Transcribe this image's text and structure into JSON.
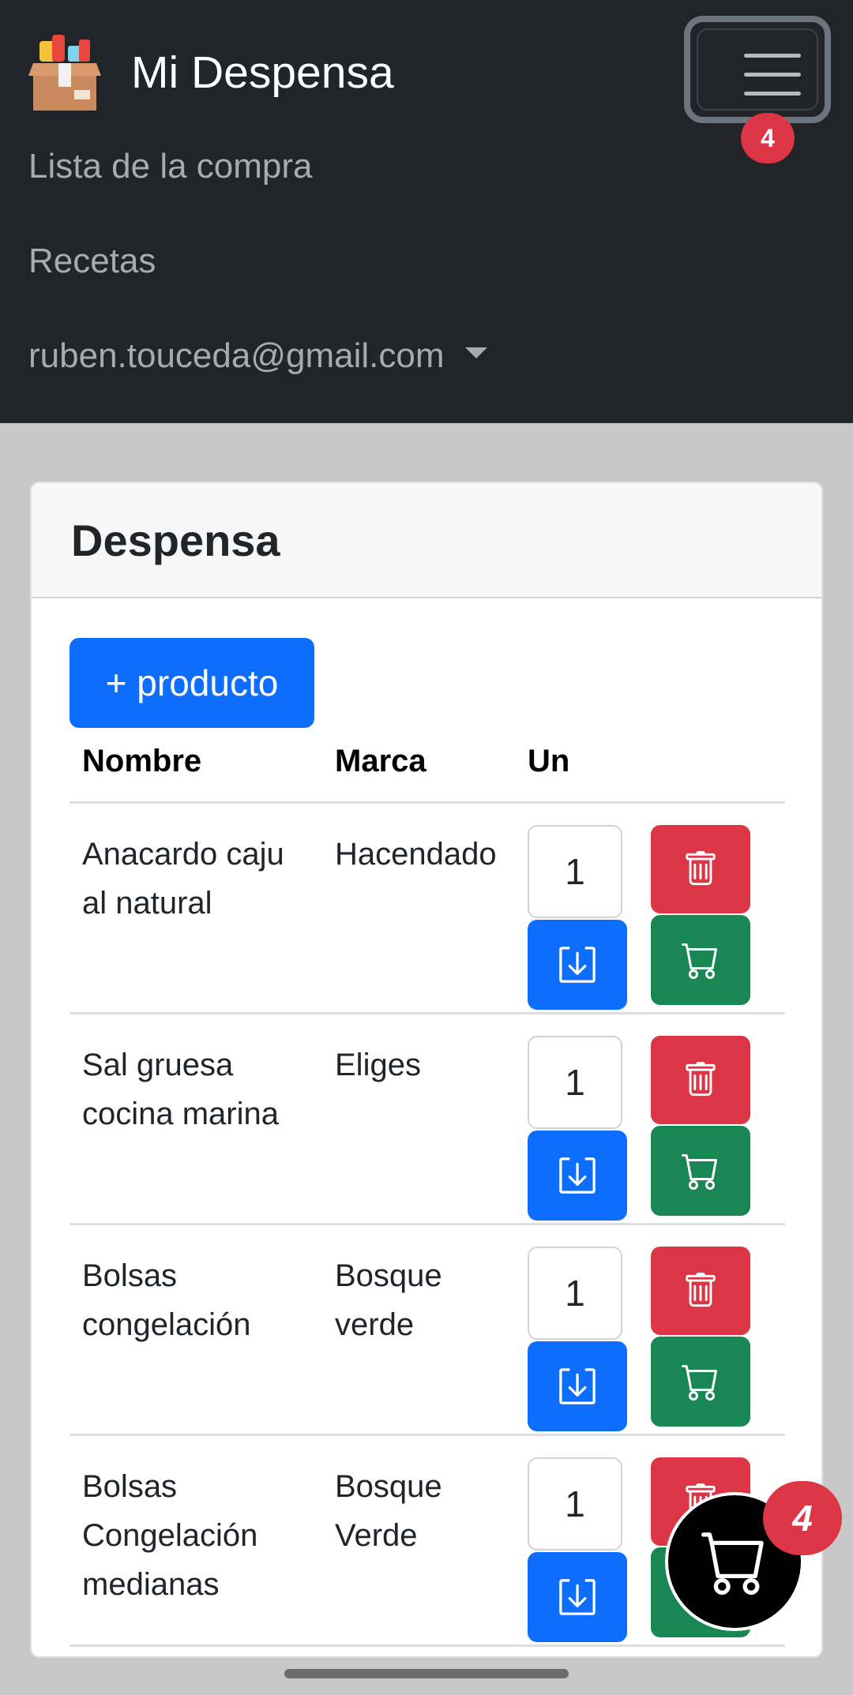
{
  "app": {
    "title": "Mi Despensa",
    "logo_icon": "pantry-box-icon"
  },
  "nav": {
    "toggle_badge": "4",
    "links": [
      {
        "label": "Lista de la compra"
      },
      {
        "label": "Recetas"
      },
      {
        "label": "ruben.touceda@gmail.com"
      }
    ]
  },
  "card": {
    "title": "Despensa",
    "add_button": "+ producto",
    "headers": {
      "name": "Nombre",
      "brand": "Marca",
      "units": "Un"
    },
    "rows": [
      {
        "name_lines": [
          "Anacardo caju",
          "al natural"
        ],
        "brand_lines": [
          "Hacendado"
        ],
        "qty": "1"
      },
      {
        "name_lines": [
          "Sal gruesa",
          "cocina marina"
        ],
        "brand_lines": [
          "Eliges"
        ],
        "qty": "1"
      },
      {
        "name_lines": [
          "Bolsas",
          "congelación"
        ],
        "brand_lines": [
          "Bosque",
          "verde"
        ],
        "qty": "1"
      },
      {
        "name_lines": [
          "Bolsas",
          "Congelación",
          "medianas"
        ],
        "brand_lines": [
          "Bosque",
          "Verde"
        ],
        "qty": "1"
      }
    ]
  },
  "floating_cart": {
    "badge": "4",
    "icon": "cart-icon"
  },
  "colors": {
    "navbar": "#212529",
    "primary": "#0d6efd",
    "danger": "#dc3545",
    "success": "#198754"
  }
}
